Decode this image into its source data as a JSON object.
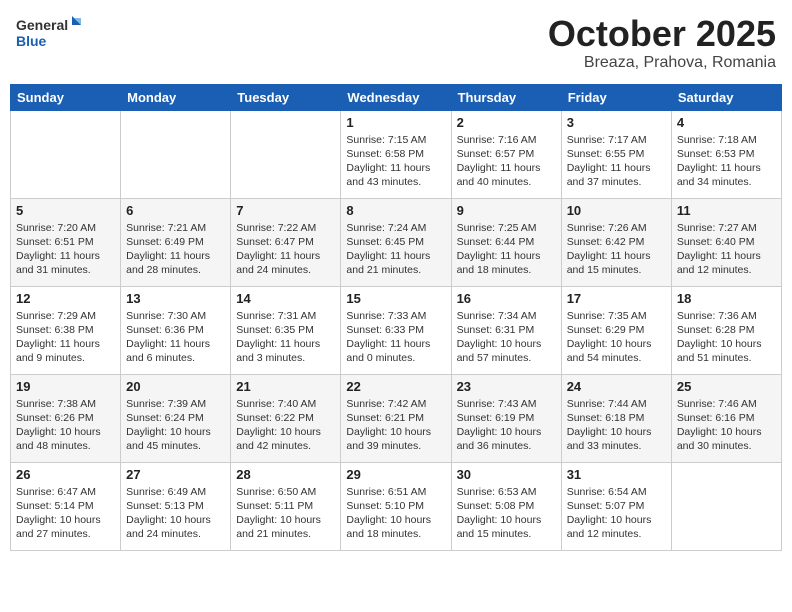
{
  "header": {
    "logo_general": "General",
    "logo_blue": "Blue",
    "month": "October 2025",
    "location": "Breaza, Prahova, Romania"
  },
  "weekdays": [
    "Sunday",
    "Monday",
    "Tuesday",
    "Wednesday",
    "Thursday",
    "Friday",
    "Saturday"
  ],
  "weeks": [
    [
      {
        "day": "",
        "info": ""
      },
      {
        "day": "",
        "info": ""
      },
      {
        "day": "",
        "info": ""
      },
      {
        "day": "1",
        "info": "Sunrise: 7:15 AM\nSunset: 6:58 PM\nDaylight: 11 hours\nand 43 minutes."
      },
      {
        "day": "2",
        "info": "Sunrise: 7:16 AM\nSunset: 6:57 PM\nDaylight: 11 hours\nand 40 minutes."
      },
      {
        "day": "3",
        "info": "Sunrise: 7:17 AM\nSunset: 6:55 PM\nDaylight: 11 hours\nand 37 minutes."
      },
      {
        "day": "4",
        "info": "Sunrise: 7:18 AM\nSunset: 6:53 PM\nDaylight: 11 hours\nand 34 minutes."
      }
    ],
    [
      {
        "day": "5",
        "info": "Sunrise: 7:20 AM\nSunset: 6:51 PM\nDaylight: 11 hours\nand 31 minutes."
      },
      {
        "day": "6",
        "info": "Sunrise: 7:21 AM\nSunset: 6:49 PM\nDaylight: 11 hours\nand 28 minutes."
      },
      {
        "day": "7",
        "info": "Sunrise: 7:22 AM\nSunset: 6:47 PM\nDaylight: 11 hours\nand 24 minutes."
      },
      {
        "day": "8",
        "info": "Sunrise: 7:24 AM\nSunset: 6:45 PM\nDaylight: 11 hours\nand 21 minutes."
      },
      {
        "day": "9",
        "info": "Sunrise: 7:25 AM\nSunset: 6:44 PM\nDaylight: 11 hours\nand 18 minutes."
      },
      {
        "day": "10",
        "info": "Sunrise: 7:26 AM\nSunset: 6:42 PM\nDaylight: 11 hours\nand 15 minutes."
      },
      {
        "day": "11",
        "info": "Sunrise: 7:27 AM\nSunset: 6:40 PM\nDaylight: 11 hours\nand 12 minutes."
      }
    ],
    [
      {
        "day": "12",
        "info": "Sunrise: 7:29 AM\nSunset: 6:38 PM\nDaylight: 11 hours\nand 9 minutes."
      },
      {
        "day": "13",
        "info": "Sunrise: 7:30 AM\nSunset: 6:36 PM\nDaylight: 11 hours\nand 6 minutes."
      },
      {
        "day": "14",
        "info": "Sunrise: 7:31 AM\nSunset: 6:35 PM\nDaylight: 11 hours\nand 3 minutes."
      },
      {
        "day": "15",
        "info": "Sunrise: 7:33 AM\nSunset: 6:33 PM\nDaylight: 11 hours\nand 0 minutes."
      },
      {
        "day": "16",
        "info": "Sunrise: 7:34 AM\nSunset: 6:31 PM\nDaylight: 10 hours\nand 57 minutes."
      },
      {
        "day": "17",
        "info": "Sunrise: 7:35 AM\nSunset: 6:29 PM\nDaylight: 10 hours\nand 54 minutes."
      },
      {
        "day": "18",
        "info": "Sunrise: 7:36 AM\nSunset: 6:28 PM\nDaylight: 10 hours\nand 51 minutes."
      }
    ],
    [
      {
        "day": "19",
        "info": "Sunrise: 7:38 AM\nSunset: 6:26 PM\nDaylight: 10 hours\nand 48 minutes."
      },
      {
        "day": "20",
        "info": "Sunrise: 7:39 AM\nSunset: 6:24 PM\nDaylight: 10 hours\nand 45 minutes."
      },
      {
        "day": "21",
        "info": "Sunrise: 7:40 AM\nSunset: 6:22 PM\nDaylight: 10 hours\nand 42 minutes."
      },
      {
        "day": "22",
        "info": "Sunrise: 7:42 AM\nSunset: 6:21 PM\nDaylight: 10 hours\nand 39 minutes."
      },
      {
        "day": "23",
        "info": "Sunrise: 7:43 AM\nSunset: 6:19 PM\nDaylight: 10 hours\nand 36 minutes."
      },
      {
        "day": "24",
        "info": "Sunrise: 7:44 AM\nSunset: 6:18 PM\nDaylight: 10 hours\nand 33 minutes."
      },
      {
        "day": "25",
        "info": "Sunrise: 7:46 AM\nSunset: 6:16 PM\nDaylight: 10 hours\nand 30 minutes."
      }
    ],
    [
      {
        "day": "26",
        "info": "Sunrise: 6:47 AM\nSunset: 5:14 PM\nDaylight: 10 hours\nand 27 minutes."
      },
      {
        "day": "27",
        "info": "Sunrise: 6:49 AM\nSunset: 5:13 PM\nDaylight: 10 hours\nand 24 minutes."
      },
      {
        "day": "28",
        "info": "Sunrise: 6:50 AM\nSunset: 5:11 PM\nDaylight: 10 hours\nand 21 minutes."
      },
      {
        "day": "29",
        "info": "Sunrise: 6:51 AM\nSunset: 5:10 PM\nDaylight: 10 hours\nand 18 minutes."
      },
      {
        "day": "30",
        "info": "Sunrise: 6:53 AM\nSunset: 5:08 PM\nDaylight: 10 hours\nand 15 minutes."
      },
      {
        "day": "31",
        "info": "Sunrise: 6:54 AM\nSunset: 5:07 PM\nDaylight: 10 hours\nand 12 minutes."
      },
      {
        "day": "",
        "info": ""
      }
    ]
  ]
}
